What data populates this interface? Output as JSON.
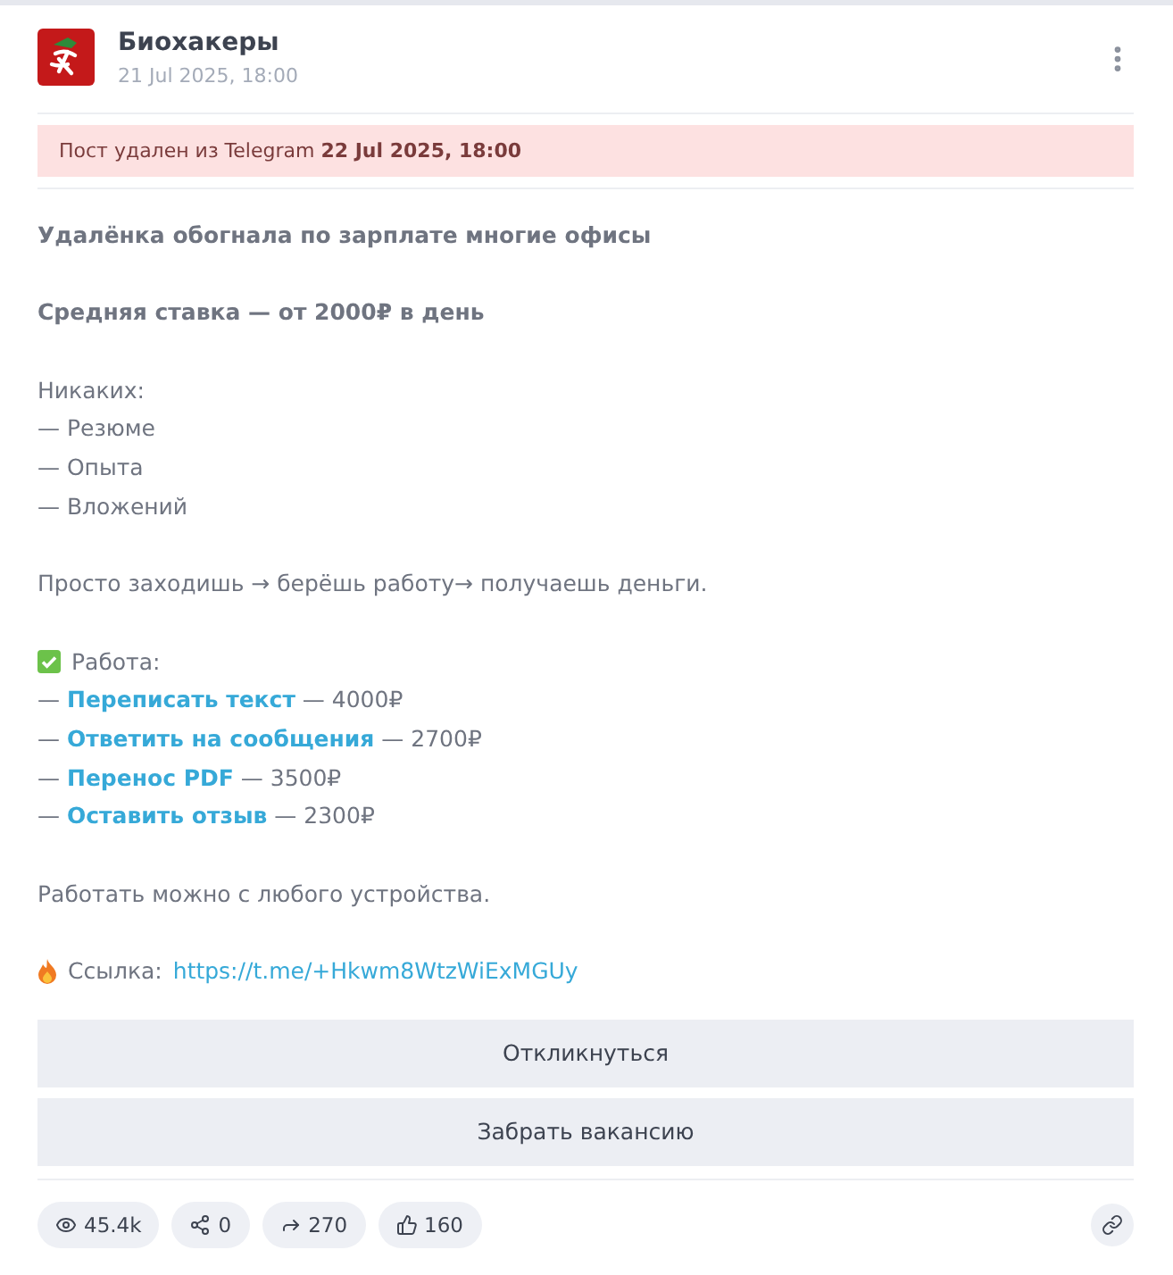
{
  "channel": {
    "name": "Биохакеры",
    "date": "21 Jul 2025, 18:00"
  },
  "notice": "Пост удален из Telegram **22 Jul 2025, 18:00**",
  "lines": [
    {
      "kind": "bold",
      "text": "Удалёнка обогнала по зарплате многие офисы"
    },
    {
      "kind": "blank"
    },
    {
      "kind": "bold",
      "text": "Средняя ставка — от 2000₽ в день"
    },
    {
      "kind": "blank"
    },
    {
      "kind": "text",
      "text": "Никаких:"
    },
    {
      "kind": "text",
      "text": "— Резюме"
    },
    {
      "kind": "text",
      "text": "— Опыта"
    },
    {
      "kind": "text",
      "text": "— Вложений"
    },
    {
      "kind": "blank"
    },
    {
      "kind": "text",
      "text": "Просто заходишь → берёшь работу→ получаешь деньги."
    },
    {
      "kind": "blank"
    },
    {
      "kind": "check",
      "text": "Работа:"
    },
    {
      "kind": "job",
      "text": "— **Переписать текст** — 4000₽"
    },
    {
      "kind": "job",
      "text": "— **Ответить на сообщения** — 2700₽"
    },
    {
      "kind": "job",
      "text": "— **Перенос PDF** — 3500₽"
    },
    {
      "kind": "job",
      "text": "— **Оставить отзыв** — 2300₽"
    },
    {
      "kind": "blank"
    },
    {
      "kind": "text",
      "text": "Работать можно с любого устройства."
    },
    {
      "kind": "blank"
    },
    {
      "kind": "fire",
      "text": "Ссылка:",
      "url": "https://t.me/+Hkwm8WtzWiExMGUy"
    }
  ],
  "buttons": [
    "Откликнуться",
    "Забрать вакансию"
  ],
  "stats": [
    {
      "kind": "views",
      "value": "45.4k"
    },
    {
      "kind": "shares",
      "value": "0"
    },
    {
      "kind": "forwards",
      "value": "270"
    },
    {
      "kind": "likes",
      "value": "160"
    }
  ]
}
